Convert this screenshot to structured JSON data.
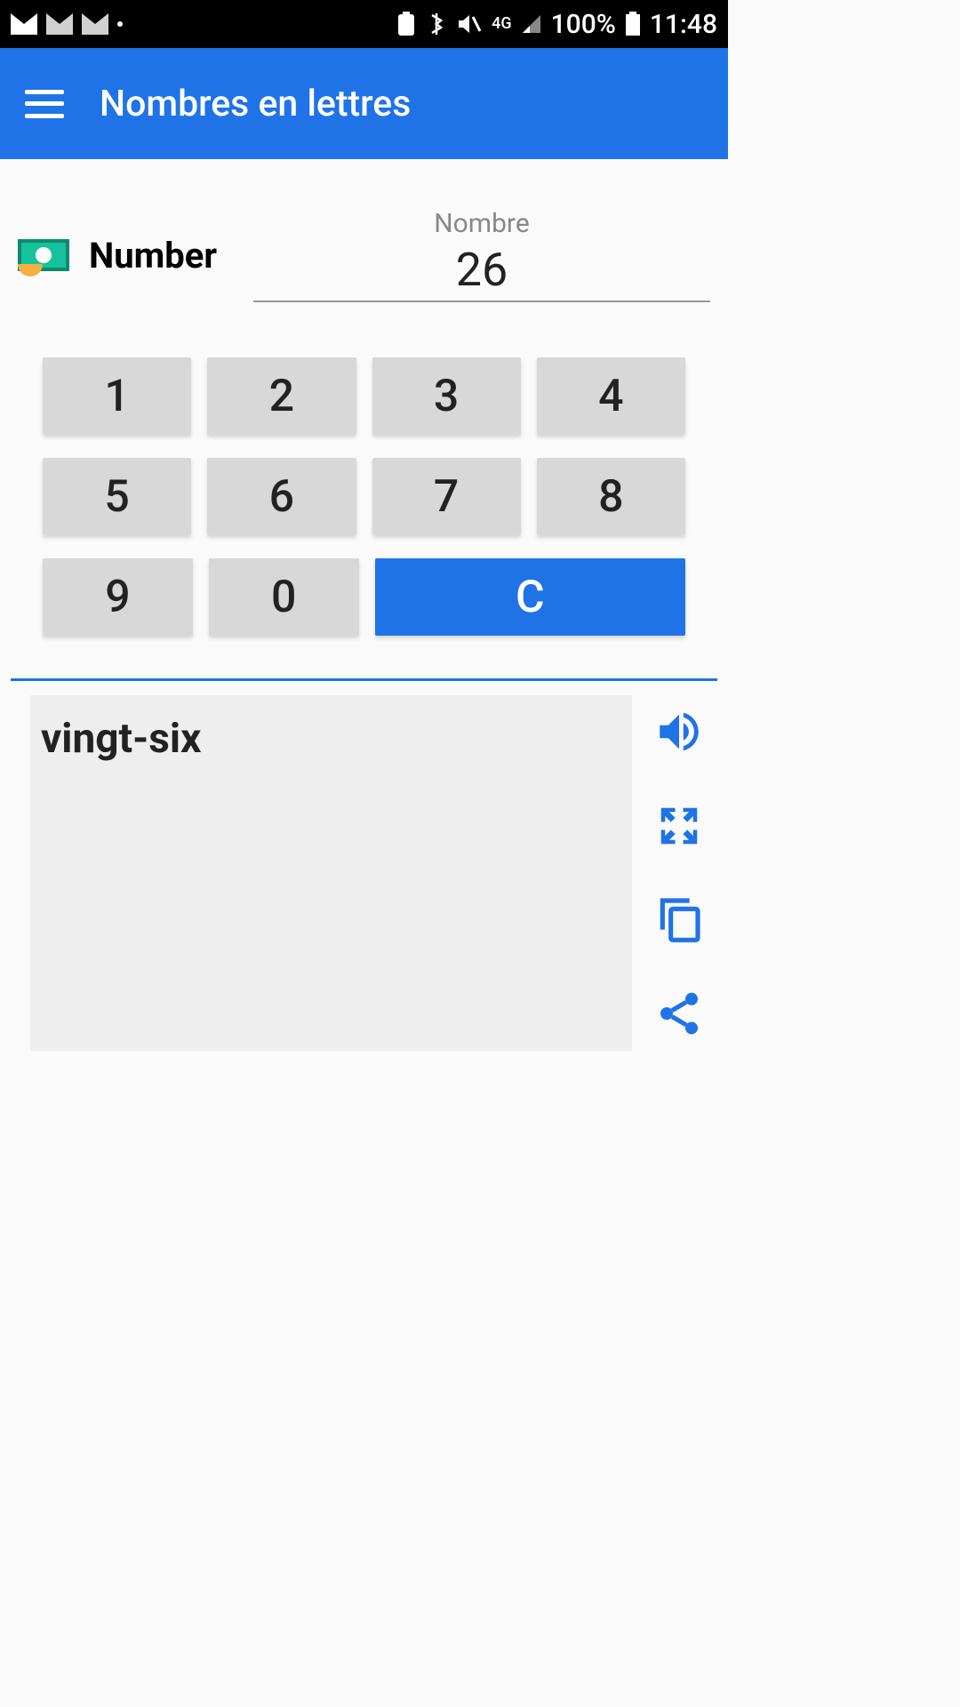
{
  "status": {
    "battery_pct": "100%",
    "time": "11:48",
    "network": "4G"
  },
  "header": {
    "title": "Nombres en lettres"
  },
  "input": {
    "label": "Number",
    "placeholder": "Nombre",
    "value": "26"
  },
  "keypad": {
    "k1": "1",
    "k2": "2",
    "k3": "3",
    "k4": "4",
    "k5": "5",
    "k6": "6",
    "k7": "7",
    "k8": "8",
    "k9": "9",
    "k0": "0",
    "clear": "C"
  },
  "result": {
    "text": "vingt-six"
  }
}
